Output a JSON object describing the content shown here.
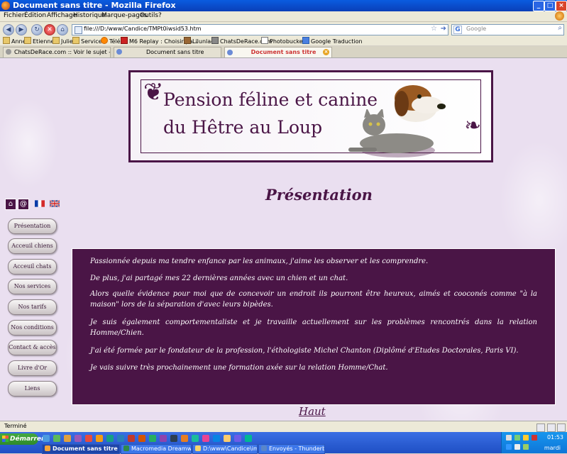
{
  "window": {
    "title": "Document sans titre - Mozilla Firefox"
  },
  "menu": [
    "Fichier",
    "Édition",
    "Affichage",
    "Historique",
    "Marque-pages",
    "Outils",
    "?"
  ],
  "address": {
    "url": "file:///D:/www/Candice/TMPt0iwsid53.htm"
  },
  "search": {
    "placeholder": "Google"
  },
  "bookmarks": [
    "Anne",
    "Etienne",
    "Julie",
    "Services",
    "Télé",
    "M6 Replay : Choisir pa...",
    "Lilunlae",
    "ChatsDeRace.com",
    "Photobucket2",
    "Google Traduction"
  ],
  "tabs": [
    {
      "label": "ChatsDeRace.com :: Voir le sujet - Nou..."
    },
    {
      "label": "Document sans titre"
    },
    {
      "label": "Document sans titre"
    }
  ],
  "page": {
    "banner_line1": "Pension féline et canine",
    "banner_line2": "du Hêtre au Loup",
    "heading": "Présentation",
    "top_icons": [
      {
        "icon": "home-icon"
      },
      {
        "icon": "at-icon",
        "glyph": "@"
      }
    ],
    "nav": [
      "Présentation",
      "Acceuil chiens",
      "Acceuil chats",
      "Nos services",
      "Nos tarifs",
      "Nos conditions",
      "Contact & accès",
      "Livre d'Or",
      "Liens"
    ],
    "paragraphs": [
      "Passionnée depuis ma tendre enfance par les animaux, j'aime les observer et les comprendre.",
      "De plus, j'ai partagé mes 22 dernières années avec un chien et un chat.",
      "Alors quelle évidence pour moi que de concevoir un endroit ils pourront être heureux, aimés et cooconés comme \"à la maison\" lors de la séparation d'avec leurs bipèdes.",
      "Je suis également comportementaliste et je travaille actuellement sur les problèmes rencontrés dans la relation Homme/Chien.",
      "J'ai été formée par le fondateur de la profession, l'éthologiste Michel Chanton (Diplômé d'Etudes Doctorales, Paris VI).",
      "Je vais suivre très prochainement une formation axée sur la relation Homme/Chat."
    ],
    "top_link": "Haut"
  },
  "status": {
    "text": "Terminé"
  },
  "taskbar": {
    "start": "Démarrer",
    "tasks": [
      "Document sans titre -...",
      "Macromedia Dreamweav...",
      "D:\\www\\Candice\\images",
      "Envoyés - Thunderbird"
    ],
    "clock": "01:53",
    "day": "mardi"
  }
}
